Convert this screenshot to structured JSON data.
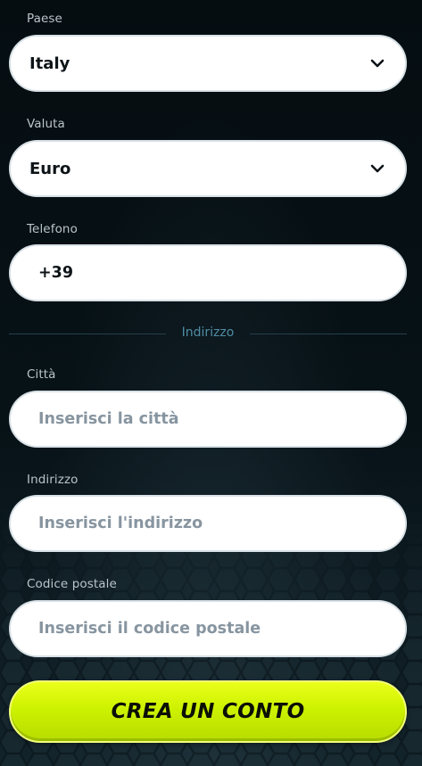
{
  "form": {
    "country": {
      "label": "Paese",
      "value": "Italy"
    },
    "currency": {
      "label": "Valuta",
      "value": "Euro"
    },
    "phone": {
      "label": "Telefono",
      "value": "+39"
    }
  },
  "address_section": {
    "heading": "Indirizzo",
    "city": {
      "label": "Città",
      "placeholder": "Inserisci la città",
      "value": ""
    },
    "street": {
      "label": "Indirizzo",
      "placeholder": "Inserisci l'indirizzo",
      "value": ""
    },
    "postal_code": {
      "label": "Codice postale",
      "placeholder": "Inserisci il codice postale",
      "value": ""
    }
  },
  "submit_label": "CREA UN CONTO",
  "colors": {
    "cta": "#d4f500",
    "divider_text": "#4f8ca3",
    "background": "#071015"
  },
  "icons": {
    "select_arrow": "chevron-down-icon"
  }
}
